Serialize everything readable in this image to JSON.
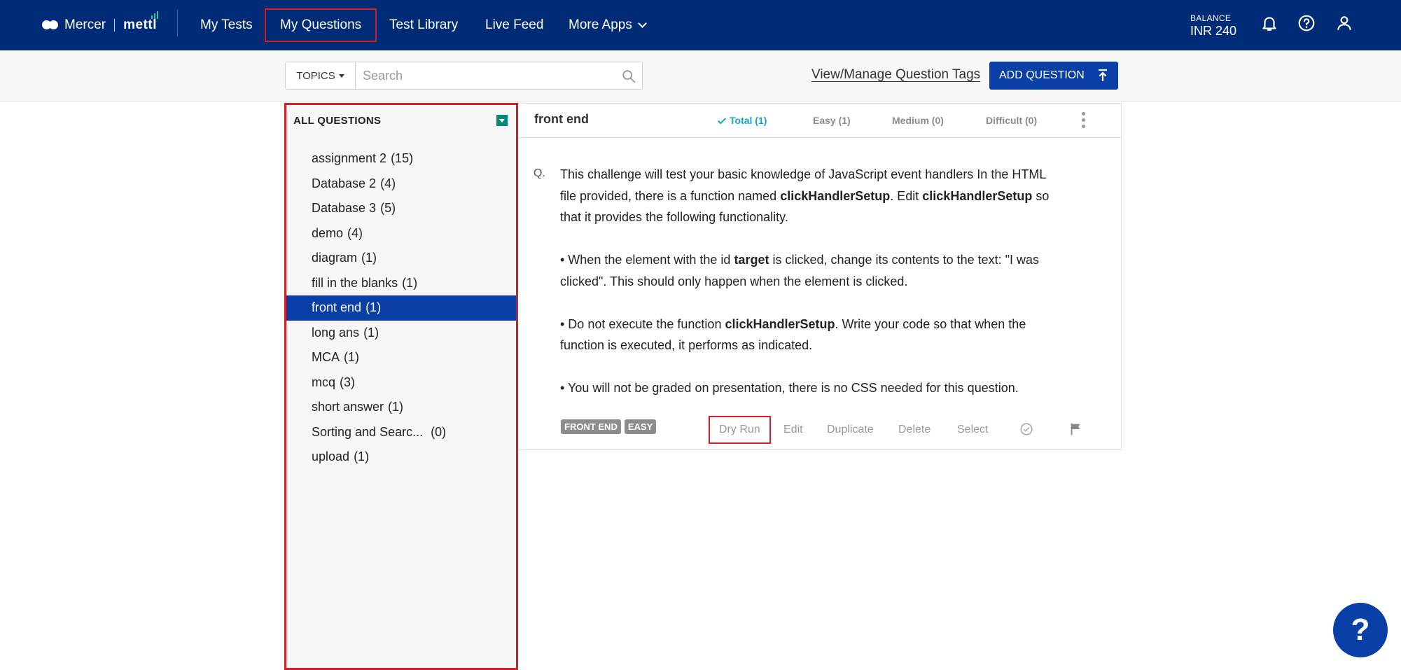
{
  "brand": {
    "left": "Mercer",
    "right": "mettl"
  },
  "nav": {
    "items": [
      {
        "label": "My Tests",
        "active": false
      },
      {
        "label": "My Questions",
        "active": true
      },
      {
        "label": "Test Library",
        "active": false
      },
      {
        "label": "Live Feed",
        "active": false
      },
      {
        "label": "More Apps",
        "active": false
      }
    ],
    "balance_label": "BALANCE",
    "balance_value": "INR 240",
    "icons": [
      "bell-icon",
      "help-circle-icon",
      "user-icon"
    ]
  },
  "toolbar": {
    "topics_label": "TOPICS",
    "search_placeholder": "Search",
    "search_value": "",
    "manage_tags": "View/Manage Question Tags",
    "add_question": "ADD QUESTION"
  },
  "sidebar": {
    "header": "ALL QUESTIONS",
    "items": [
      {
        "name": "assignment 2",
        "count": "(15)"
      },
      {
        "name": "Database 2",
        "count": "(4)"
      },
      {
        "name": "Database 3",
        "count": "(5)"
      },
      {
        "name": "demo",
        "count": "(4)"
      },
      {
        "name": "diagram",
        "count": "(1)"
      },
      {
        "name": "fill in the blanks",
        "count": "(1)"
      },
      {
        "name": "front end",
        "count": "(1)"
      },
      {
        "name": "long ans",
        "count": "(1)"
      },
      {
        "name": "MCA",
        "count": "(1)"
      },
      {
        "name": "mcq",
        "count": "(3)"
      },
      {
        "name": "short answer",
        "count": "(1)"
      },
      {
        "name": "Sorting and Searc...",
        "count": " (0)"
      },
      {
        "name": "upload",
        "count": "(1)"
      }
    ],
    "selected": "front end"
  },
  "question_panel": {
    "title": "front end",
    "filters": {
      "total": "Total (1)",
      "easy": "Easy (1)",
      "medium": "Medium (0)",
      "difficult": "Difficult (0)"
    },
    "question": {
      "prefix": "Q.",
      "p1": {
        "a": "This challenge will test your basic knowledge of JavaScript event handlers In the HTML file provided, there is a function named ",
        "b1": "clickHandlerSetup",
        "c": ". Edit ",
        "b2": "clickHandlerSetup",
        "d": " so that it provides the following functionality."
      },
      "p2": {
        "a": "• When the element with the id ",
        "b": "target",
        "c": " is clicked, change its contents to the text: \"I was clicked\". This should only happen when the element is clicked."
      },
      "p3": {
        "a": "• Do not execute the function ",
        "b": "clickHandlerSetup",
        "c": ". Write your code so that when the function is executed, it performs as indicated."
      },
      "p4": "• You will not be graded on presentation, there is no CSS needed for this question."
    },
    "tags": [
      "FRONT END",
      "EASY"
    ],
    "actions": {
      "dry_run": "Dry Run",
      "edit": "Edit",
      "duplicate": "Duplicate",
      "delete": "Delete",
      "select": "Select"
    }
  },
  "help_fab": "?"
}
